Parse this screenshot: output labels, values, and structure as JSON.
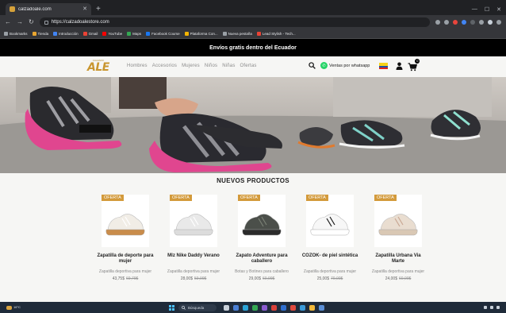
{
  "browser": {
    "tab_title": "calzadoale.com",
    "url": "https://calzadoalestore.com",
    "bookmarks": [
      {
        "label": "Bookmarks",
        "color": "#9aa0a6"
      },
      {
        "label": "Tienda",
        "color": "#e8a530"
      },
      {
        "label": "Introducción",
        "color": "#4285f4"
      },
      {
        "label": "Gmail",
        "color": "#ea4335"
      },
      {
        "label": "YouTube",
        "color": "#ff0000"
      },
      {
        "label": "Maps",
        "color": "#34a853"
      },
      {
        "label": "Facebook Course",
        "color": "#1877f2"
      },
      {
        "label": "Plataforma Con...",
        "color": "#f4b400"
      },
      {
        "label": "Nueva pestaña",
        "color": "#9aa0a6"
      },
      {
        "label": "Lead Stylish - Tech...",
        "color": "#ea4335"
      }
    ]
  },
  "promo_banner": "Envíos gratis dentro del Ecuador",
  "header": {
    "logo_small": "CALZADO",
    "logo_main": "ALE",
    "nav": [
      "Hombres",
      "Accesorios",
      "Mujeres",
      "Niños",
      "Niñas",
      "Ofertas"
    ],
    "whatsapp_label": "Ventas por whatsapp",
    "cart_count": "0"
  },
  "section_title": "NUEVOS PRODUCTOS",
  "products": [
    {
      "badge": "OFERTA",
      "name": "Zapatilla de deporte para mujer",
      "desc": "Zapatilla deportiva para mujer",
      "price": "43,75$",
      "old_price": "69,79$"
    },
    {
      "badge": "OFERTA",
      "name": "Mlz Nike Daddy Verano",
      "desc": "Zapatilla deportiva para mujer",
      "price": "28,00$",
      "old_price": "59,99$"
    },
    {
      "badge": "OFERTA",
      "name": "Zapato Adventure para caballero",
      "desc": "Botas y Botines para caballero",
      "price": "29,00$",
      "old_price": "60,99$"
    },
    {
      "badge": "OFERTA",
      "name": "COZOK- de piel sintética",
      "desc": "Zapatilla deportiva para mujer",
      "price": "25,00$",
      "old_price": "70,00$"
    },
    {
      "badge": "OFERTA",
      "name": "Zapatilla Urbana Via Marte",
      "desc": "Zapatilla deportiva para mujer",
      "price": "24,00$",
      "old_price": "60,00$"
    }
  ],
  "taskbar": {
    "weather": "16°C",
    "search_label": "Búsqueda"
  }
}
